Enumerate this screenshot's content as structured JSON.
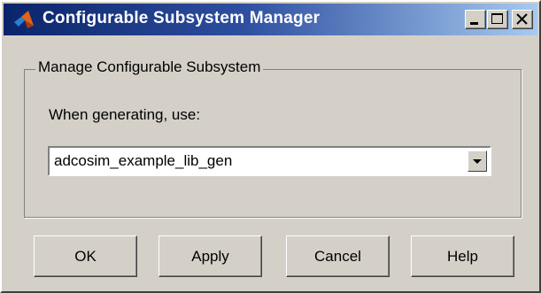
{
  "window": {
    "title": "Configurable Subsystem Manager",
    "icon": "matlab-icon",
    "controls": [
      "minimize-icon",
      "maximize-icon",
      "close-icon"
    ]
  },
  "group": {
    "title": "Manage Configurable Subsystem",
    "prompt": "When generating, use:"
  },
  "select": {
    "value": "adcosim_example_lib_gen",
    "arrow_icon": "chevron-down-icon"
  },
  "buttons": {
    "ok": "OK",
    "apply": "Apply",
    "cancel": "Cancel",
    "help": "Help"
  },
  "colors": {
    "titlebar_start": "#0a246a",
    "titlebar_end": "#a6caf0",
    "face": "#d4d0c8"
  }
}
